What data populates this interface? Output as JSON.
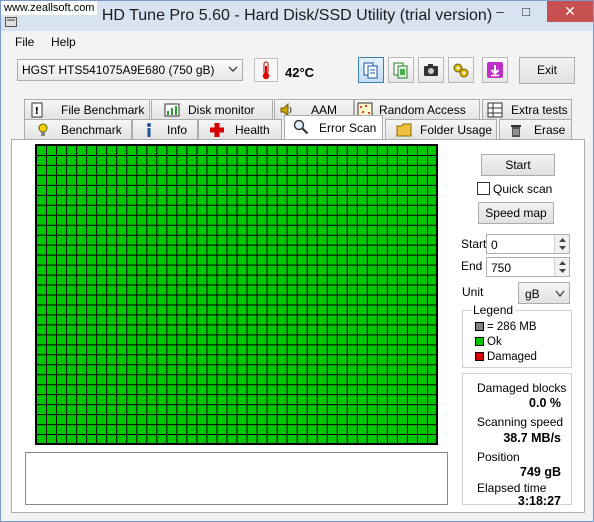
{
  "watermark": "www.zeallsoft.com",
  "window": {
    "title": "HD Tune Pro 5.60 - Hard Disk/SSD Utility (trial version)",
    "minimize": "–",
    "maximize": "□",
    "close": "✕"
  },
  "menu": {
    "file": "File",
    "help": "Help"
  },
  "toolbar": {
    "drive": "HGST HTS541075A9E680 (750 gB)",
    "temperature": "42°C",
    "exit_label": "Exit",
    "icons": [
      "copy-info-icon",
      "copy-screen-icon",
      "camera-icon",
      "settings-icon",
      "save-icon"
    ]
  },
  "tabs": {
    "row1": [
      "File Benchmark",
      "Disk monitor",
      "AAM",
      "Random Access",
      "Extra tests"
    ],
    "row2": [
      "Benchmark",
      "Info",
      "Health",
      "Error Scan",
      "Folder Usage",
      "Erase"
    ],
    "selected": "Error Scan"
  },
  "scan": {
    "grid_cols": 40,
    "grid_rows": 30,
    "colors": {
      "ok": "#00c800",
      "damaged": "#d80000",
      "unscanned": "#808080",
      "grid": "#000000"
    }
  },
  "controls": {
    "start_label": "Start",
    "quick_scan_label": "Quick scan",
    "quick_scan_checked": false,
    "speed_map_label": "Speed map",
    "start_field_label": "Start",
    "start_value": "0",
    "end_field_label": "End",
    "end_value": "750",
    "unit_label": "Unit",
    "unit_value": "gB"
  },
  "legend": {
    "title": "Legend",
    "block_size": "= 286 MB",
    "ok": "Ok",
    "damaged": "Damaged"
  },
  "stats": {
    "damaged_blocks_label": "Damaged blocks",
    "damaged_blocks_value": "0.0 %",
    "scanning_speed_label": "Scanning speed",
    "scanning_speed_value": "38.7 MB/s",
    "position_label": "Position",
    "position_value": "749 gB",
    "elapsed_label": "Elapsed time",
    "elapsed_value": "3:18:27"
  }
}
